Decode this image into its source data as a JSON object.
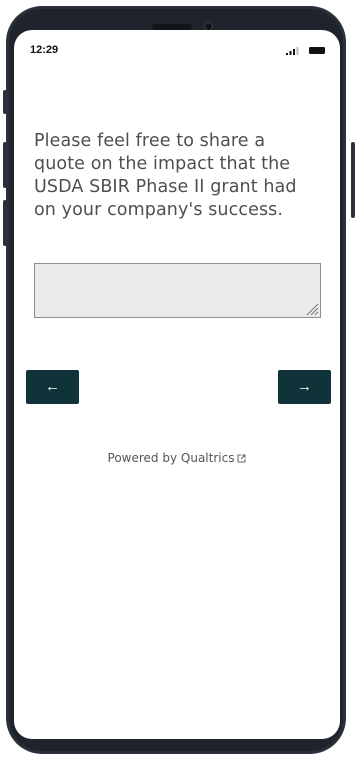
{
  "status_bar": {
    "time": "12:29"
  },
  "survey": {
    "question": "Please feel free to share a quote on the impact that the USDA SBIR Phase II grant had on your company's success.",
    "answer_value": "",
    "back_arrow": "←",
    "next_arrow": "→",
    "footer": "Powered by Qualtrics"
  },
  "icons": {
    "signal": "cellular-signal-icon",
    "battery": "battery-icon",
    "external": "external-link-icon",
    "resize": "resize-grip-icon"
  },
  "colors": {
    "frame": "#2b313b",
    "nav_button": "#0f3338",
    "question_text": "#4f4f4f",
    "textarea_bg": "#eaeaea"
  }
}
